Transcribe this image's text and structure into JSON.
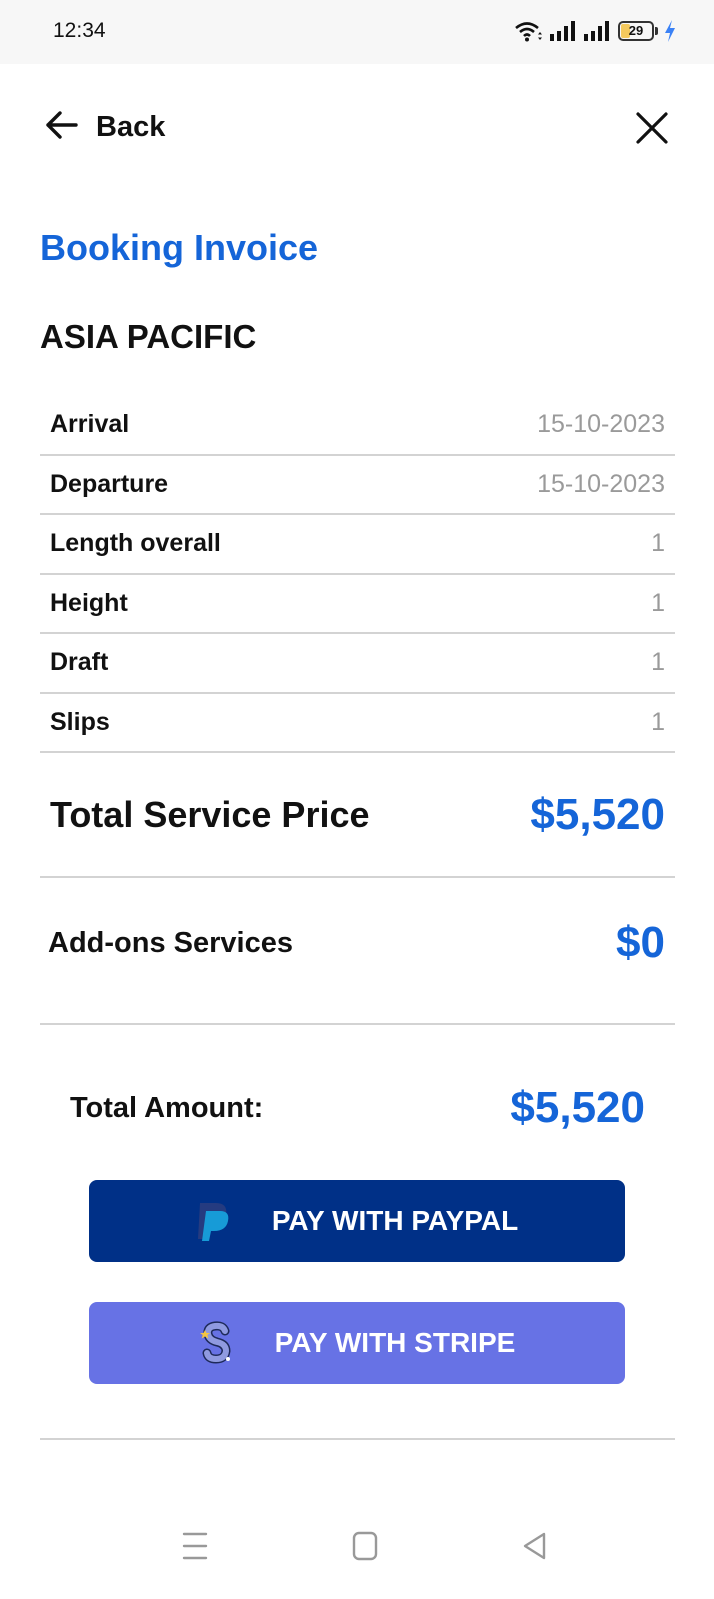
{
  "status_bar": {
    "time": "12:34",
    "battery_level": "29",
    "battery_percent": 29,
    "charging": true,
    "icons": [
      "wifi-icon",
      "signal-icon",
      "signal-icon",
      "battery-icon",
      "charging-icon"
    ]
  },
  "nav": {
    "back_label": "Back",
    "back_icon": "arrow-left-icon",
    "close_icon": "close-icon"
  },
  "page_title": "Booking Invoice",
  "section_title": "ASIA PACIFIC",
  "details": [
    {
      "label": "Arrival",
      "value": "15-10-2023"
    },
    {
      "label": "Departure",
      "value": "15-10-2023"
    },
    {
      "label": "Length overall",
      "value": "1"
    },
    {
      "label": "Height",
      "value": "1"
    },
    {
      "label": "Draft",
      "value": "1"
    },
    {
      "label": "Slips",
      "value": "1"
    }
  ],
  "summary": {
    "total_service_label": "Total Service Price",
    "total_service_value": "$5,520",
    "addons_label": "Add-ons Services",
    "addons_value": "$0",
    "total_amount_label": "Total Amount:",
    "total_amount_value": "$5,520"
  },
  "payment": {
    "paypal_label": "PAY WITH PAYPAL",
    "paypal_icon": "paypal-icon",
    "stripe_label": "PAY WITH STRIPE",
    "stripe_icon": "stripe-icon"
  },
  "colors": {
    "accent": "#1565d8",
    "paypal": "#003087",
    "stripe": "#6772e5"
  },
  "system_nav": [
    "menu-icon",
    "home-icon",
    "back-triangle-icon"
  ]
}
